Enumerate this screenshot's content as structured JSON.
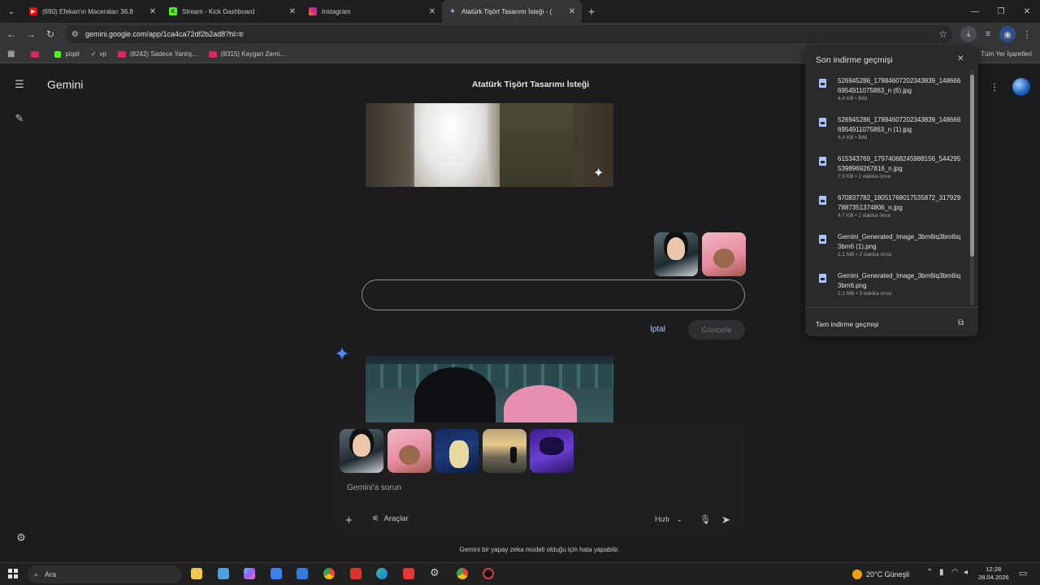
{
  "browser": {
    "tabs": [
      {
        "title": "(690) Efekan'ın Maceraları 36.8",
        "active": false,
        "favicon": "youtube"
      },
      {
        "title": "Stream - Kick Dashboard",
        "active": false,
        "favicon": "kick"
      },
      {
        "title": "Instagram",
        "active": false,
        "favicon": "instagram"
      },
      {
        "title": "Atatürk Tişört Tasarımı İsteği - (",
        "active": true,
        "favicon": "gemini"
      }
    ],
    "url": "gemini.google.com/app/1ca4ca72df2b2ad8?hl=tr",
    "bookmarks": [
      {
        "label": "popit"
      },
      {
        "label": "vp"
      },
      {
        "label": "(8242) Sadece Yanlış..."
      },
      {
        "label": "(8315) Kaygan Zemi..."
      }
    ],
    "all_bookmarks": "Tüm Yer İşaretleri"
  },
  "app": {
    "brand": "Gemini",
    "conversation_title": "Atatürk Tişört Tasarımı İsteği",
    "cancel_label": "İptal",
    "update_label": "Güncelle",
    "prompt_placeholder": "Gemini'a sorun",
    "tools_label": "Araçlar",
    "speed_label": "Hızlı",
    "disclaimer": "Gemini bir yapay zeka modeli olduğu için hata yapabilir."
  },
  "downloads": {
    "title": "Son indirme geçmişi",
    "items": [
      {
        "name": "526945286_17884607202343839_1486666954911075863_n (6).jpg",
        "meta": "4,4 KB • Bitti"
      },
      {
        "name": "526945286_17884607202343839_1486666954911075863_n (1).jpg",
        "meta": "4,4 KB • Bitti"
      },
      {
        "name": "615343769_17974068245988156_5442955398969267816_n.jpg",
        "meta": "7,5 KB • 2 dakika önce"
      },
      {
        "name": "670837782_18051768017535872_3179297887351374806_n.jpg",
        "meta": "4,7 KB • 2 dakika önce"
      },
      {
        "name": "Gemini_Generated_Image_3bm6iq3bm6iq3bm6 (1).png",
        "meta": "2,1 MB • 2 dakika önce"
      },
      {
        "name": "Gemini_Generated_Image_3bm6iq3bm6iq3bm6.png",
        "meta": "2,1 MB • 3 dakika önce"
      }
    ],
    "footer": "Tam indirme geçmişi"
  },
  "taskbar": {
    "search_placeholder": "Ara",
    "weather": "20°C  Güneşli",
    "time": "12:28",
    "date": "28.04.2026"
  },
  "colors": {
    "accent": "#a8c7fa",
    "background": "#1b1c1d",
    "gemini_star": "#4a8af4"
  }
}
